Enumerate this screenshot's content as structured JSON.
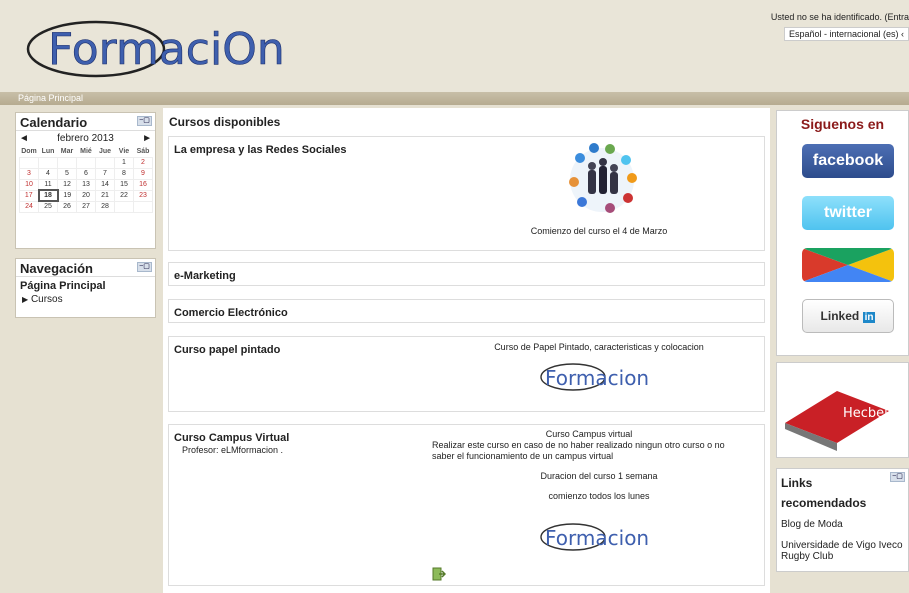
{
  "header": {
    "logo_text": "FormaciOn",
    "login_info": "Usted no se ha identificado. (Entra",
    "language": "Español - internacional (es) ‹"
  },
  "navbar": {
    "breadcrumb": "Página Principal"
  },
  "calendar": {
    "title": "Calendario",
    "hide": "−▢",
    "prev": "◄",
    "next": "►",
    "month": "febrero 2013",
    "weekdays": [
      "Dom",
      "Lun",
      "Mar",
      "Mié",
      "Jue",
      "Vie",
      "Sáb"
    ],
    "weeks": [
      [
        "",
        "",
        "",
        "",
        "",
        "1",
        "2"
      ],
      [
        "3",
        "4",
        "5",
        "6",
        "7",
        "8",
        "9"
      ],
      [
        "10",
        "11",
        "12",
        "13",
        "14",
        "15",
        "16"
      ],
      [
        "17",
        "18",
        "19",
        "20",
        "21",
        "22",
        "23"
      ],
      [
        "24",
        "25",
        "26",
        "27",
        "28",
        "",
        ""
      ]
    ],
    "today": "18"
  },
  "navigation": {
    "title": "Navegación",
    "hide": "−▢",
    "home": "Página Principal",
    "cursos": "Cursos"
  },
  "main": {
    "heading": "Cursos disponibles",
    "courses": [
      {
        "title": "La empresa y las Redes Sociales",
        "caption": "Comienzo del curso el 4 de Marzo"
      },
      {
        "title": "e-Marketing"
      },
      {
        "title": "Comercio Electrónico"
      },
      {
        "title": "Curso papel pintado",
        "desc": "Curso de Papel Pintado, caracteristicas y colocacion",
        "logo": "Formacion"
      },
      {
        "title": "Curso Campus Virtual",
        "teacher": "Profesor: eLMformacion .",
        "desc1": "Curso Campus virtual",
        "desc2": "Realizar este curso en caso de no haber realizado ningun otro curso o no saber el funcionamiento de un campus virtual",
        "desc3": "Duracion del curso 1 semana",
        "desc4": "comienzo todos los lunes",
        "logo": "Formacion"
      }
    ]
  },
  "right": {
    "siguenos": "Siguenos en",
    "facebook": "facebook",
    "twitter": "twitter",
    "linkedin": "Linked",
    "linkedin_in": "in",
    "hecbel": "Hecbel",
    "links_title1": "Links",
    "links_title2": "recomendados",
    "hide": "−▢",
    "links": [
      "Blog de Moda",
      "Universidade de Vigo Iveco Rugby Club"
    ]
  },
  "colors": {
    "accent": "#8b1a1a",
    "facebook": "#3b5998",
    "twitter": "#4fc3ef"
  }
}
